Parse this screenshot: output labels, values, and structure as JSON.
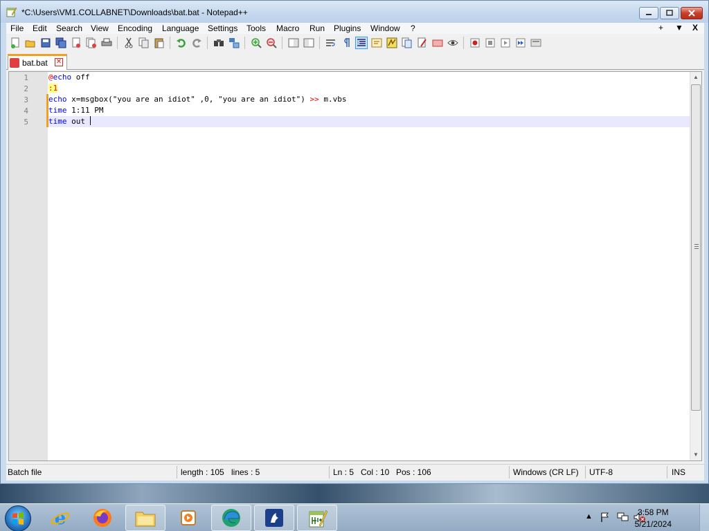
{
  "window": {
    "title": "*C:\\Users\\VM1.COLLABNET\\Downloads\\bat.bat - Notepad++"
  },
  "menu": {
    "items": [
      "File",
      "Edit",
      "Search",
      "View",
      "Encoding",
      "Language",
      "Settings",
      "Tools",
      "Macro",
      "Run",
      "Plugins",
      "Window",
      "?"
    ],
    "right": [
      "+",
      "▼",
      "X"
    ]
  },
  "toolbar": {
    "icons": [
      "new-file-icon",
      "open-file-icon",
      "save-icon",
      "save-all-icon",
      "close-icon",
      "close-all-icon",
      "print-icon",
      "cut-icon",
      "copy-icon",
      "paste-icon",
      "undo-icon",
      "redo-icon",
      "find-icon",
      "replace-icon",
      "zoom-in-icon",
      "zoom-out-icon",
      "sync-vertical-icon",
      "sync-horizontal-icon",
      "word-wrap-icon",
      "show-all-characters-icon",
      "indent-guide-icon",
      "udl-icon",
      "document-map-icon",
      "function-list-icon",
      "folder-as-workspace-icon",
      "monitoring-icon",
      "record-macro-icon",
      "stop-macro-icon",
      "play-macro-icon",
      "run-macro-multiple-icon",
      "save-macro-icon"
    ]
  },
  "tabs": [
    {
      "label": "bat.bat",
      "active": true,
      "modified": true
    }
  ],
  "editor": {
    "line_numbers": [
      "1",
      "2",
      "3",
      "4",
      "5"
    ],
    "lines": [
      {
        "at": "@",
        "kw": "echo",
        "rest": " off"
      },
      {
        "label": ":1"
      },
      {
        "kw": "echo",
        "rest": " x=msgbox(\"you are an idiot\" ,0, \"you are an idiot\") ",
        "redir": ">>",
        "tail": " m.vbs"
      },
      {
        "kw": "time",
        "rest": " 1:11 PM"
      },
      {
        "kw": "time",
        "rest": " out "
      }
    ],
    "current_line": 5
  },
  "statusbar": {
    "file_type": "Batch file",
    "length": "length : 105",
    "lines": "lines : 5",
    "ln": "Ln : 5",
    "col": "Col : 10",
    "pos": "Pos : 106",
    "eol": "Windows (CR LF)",
    "encoding": "UTF-8",
    "mode": "INS"
  },
  "taskbar": {
    "apps": [
      "internet-explorer-icon",
      "firefox-icon",
      "file-explorer-icon",
      "media-player-icon",
      "edge-icon",
      "app-icon",
      "notepadpp-icon"
    ],
    "time": "3:58 PM",
    "date": "5/21/2024"
  },
  "colors": {
    "keyword": "#0000ff",
    "operator": "#ff0000",
    "label_bg": "#ffff80",
    "current_line_bg": "#e8e8ff",
    "modified_marker": "#f0a020"
  }
}
